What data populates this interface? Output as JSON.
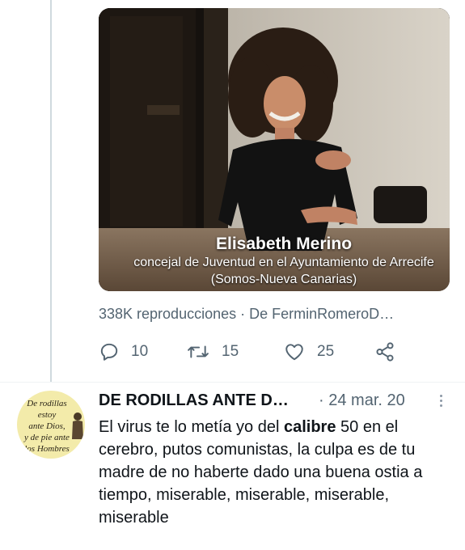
{
  "media": {
    "caption_name": "Elisabeth Merino",
    "caption_role": "concejal de Juventud en el Ayuntamiento de Arrecife",
    "caption_party": "(Somos-Nueva Canarias)"
  },
  "views_text": "338K reproducciones · De FerminRomeroD…",
  "actions": {
    "reply_icon": "reply-icon",
    "reply_count": "10",
    "retweet_icon": "retweet-icon",
    "retweet_count": "15",
    "like_icon": "heart-icon",
    "like_count": "25",
    "share_icon": "share-icon"
  },
  "reply_tweet": {
    "avatar_lines": [
      "De rodillas",
      "estoy",
      "ante Dios,",
      "y de pie ante",
      "los Hombres"
    ],
    "author": "DE RODILLAS ANTE D…",
    "separator": "·",
    "date": "24 mar. 20",
    "text_before": "El virus te lo metía yo del ",
    "text_bold": "calibre",
    "text_after": " 50 en el cerebro,  putos comunistas,  la culpa es de tu madre de no haberte dado una buena ostia a tiempo,  miserable, miserable, miserable, miserable"
  },
  "colors": {
    "secondary_text": "#536471",
    "primary_text": "#0f1419",
    "thread_line": "#cfd9de"
  }
}
